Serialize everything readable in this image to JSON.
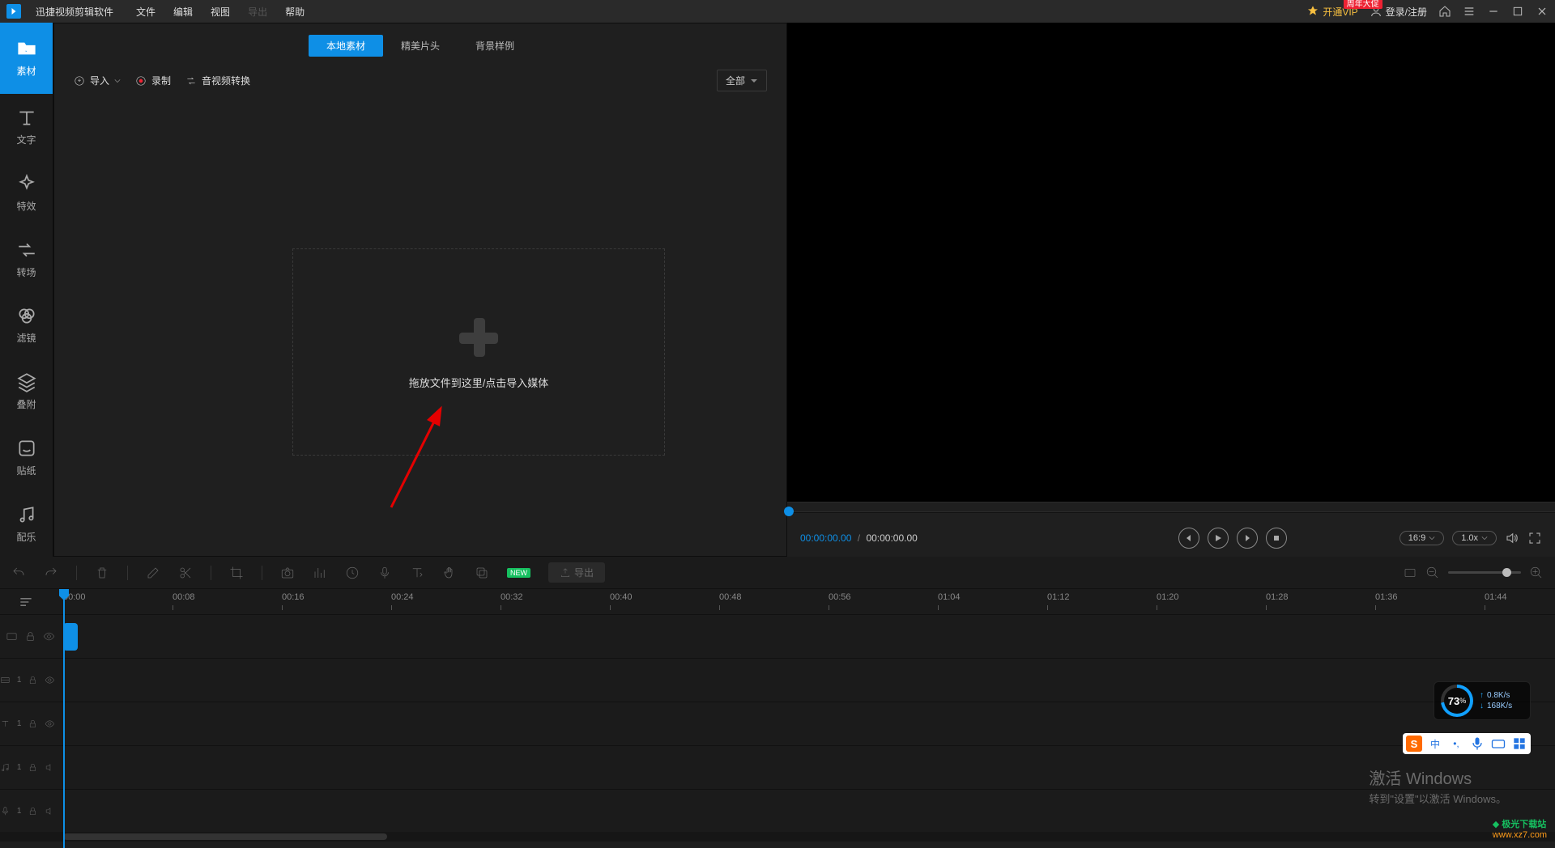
{
  "titlebar": {
    "app_name": "迅捷视频剪辑软件",
    "menus": [
      "文件",
      "编辑",
      "视图",
      "导出",
      "帮助"
    ],
    "disabled_index": 3,
    "vip_label": "开通VIP",
    "vip_promo": "周年大促",
    "login_label": "登录/注册"
  },
  "rail": [
    {
      "label": "素材",
      "icon": "folder"
    },
    {
      "label": "文字",
      "icon": "text"
    },
    {
      "label": "特效",
      "icon": "sparkle"
    },
    {
      "label": "转场",
      "icon": "transition"
    },
    {
      "label": "滤镜",
      "icon": "filter"
    },
    {
      "label": "叠附",
      "icon": "layers"
    },
    {
      "label": "贴纸",
      "icon": "sticker"
    },
    {
      "label": "配乐",
      "icon": "music"
    }
  ],
  "media_panel": {
    "tabs": [
      "本地素材",
      "精美片头",
      "背景样例"
    ],
    "active_tab": 0,
    "import_btn": "导入",
    "record_btn": "录制",
    "convert_btn": "音视频转换",
    "filter_label": "全部",
    "dropzone_text": "拖放文件到这里/点击导入媒体"
  },
  "preview": {
    "current_time": "00:00:00.00",
    "total_time": "00:00:00.00",
    "aspect": "16:9",
    "speed": "1.0x"
  },
  "timeline": {
    "export_label": "导出",
    "new_tag": "NEW",
    "ruler_start": "00:00",
    "ticks": [
      "00:00",
      "00:08",
      "00:16",
      "00:24",
      "00:32",
      "00:40",
      "00:48",
      "00:56",
      "01:04",
      "01:12",
      "01:20",
      "01:28",
      "01:36",
      "01:44"
    ]
  },
  "overlay": {
    "cpu_percent": "73",
    "cpu_unit": "%",
    "net_up": "0.8K/s",
    "net_down": "168K/s",
    "ime_char": "中",
    "activate_title": "激活 Windows",
    "activate_sub": "转到\"设置\"以激活 Windows。",
    "watermark_brand": "极光下载站",
    "watermark_url": "www.xz7.com"
  }
}
